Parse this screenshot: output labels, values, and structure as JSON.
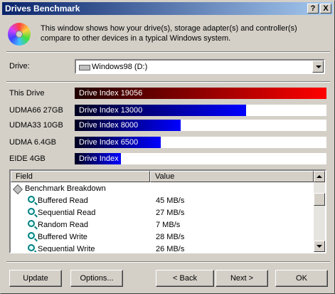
{
  "window": {
    "title": "Drives Benchmark",
    "help_label": "?",
    "close_label": "X"
  },
  "intro": {
    "text": "This window shows how your drive(s), storage adapter(s) and controller(s) compare to other devices in a typical Windows system."
  },
  "drive_select": {
    "label": "Drive:",
    "value": "Windows98 (D:)"
  },
  "benchmarks": [
    {
      "label": "This Drive",
      "bar_text": "Drive Index 19056",
      "index": 19056,
      "color_start": "#200000",
      "color_end": "#ff0000"
    },
    {
      "label": "UDMA66 27GB",
      "bar_text": "Drive Index 13000",
      "index": 13000,
      "color_start": "#000020",
      "color_end": "#0000ff"
    },
    {
      "label": "UDMA33 10GB",
      "bar_text": "Drive Index 8000",
      "index": 8000,
      "color_start": "#000020",
      "color_end": "#0000ff"
    },
    {
      "label": "UDMA 6.4GB",
      "bar_text": "Drive Index 6500",
      "index": 6500,
      "color_start": "#000020",
      "color_end": "#0000ff"
    },
    {
      "label": "EIDE 4GB",
      "bar_text": "Drive Index 3500",
      "index": 3500,
      "color_start": "#000020",
      "color_end": "#0000ff"
    }
  ],
  "scale_max": 19056,
  "table": {
    "headers": {
      "field": "Field",
      "value": "Value"
    },
    "rows": [
      {
        "field": "Benchmark Breakdown",
        "value": "",
        "icon": "diamond-icon",
        "group": true
      },
      {
        "field": "Buffered Read",
        "value": "45 MB/s",
        "icon": "magnifier-icon",
        "group": false
      },
      {
        "field": "Sequential Read",
        "value": "27 MB/s",
        "icon": "magnifier-icon",
        "group": false
      },
      {
        "field": "Random Read",
        "value": "7 MB/s",
        "icon": "magnifier-icon",
        "group": false
      },
      {
        "field": "Buffered Write",
        "value": "28 MB/s",
        "icon": "magnifier-icon",
        "group": false
      },
      {
        "field": "Sequential Write",
        "value": "26 MB/s",
        "icon": "magnifier-icon",
        "group": false
      }
    ]
  },
  "buttons": {
    "update": "Update",
    "options": "Options...",
    "back": "< Back",
    "next": "Next >",
    "ok": "OK"
  }
}
